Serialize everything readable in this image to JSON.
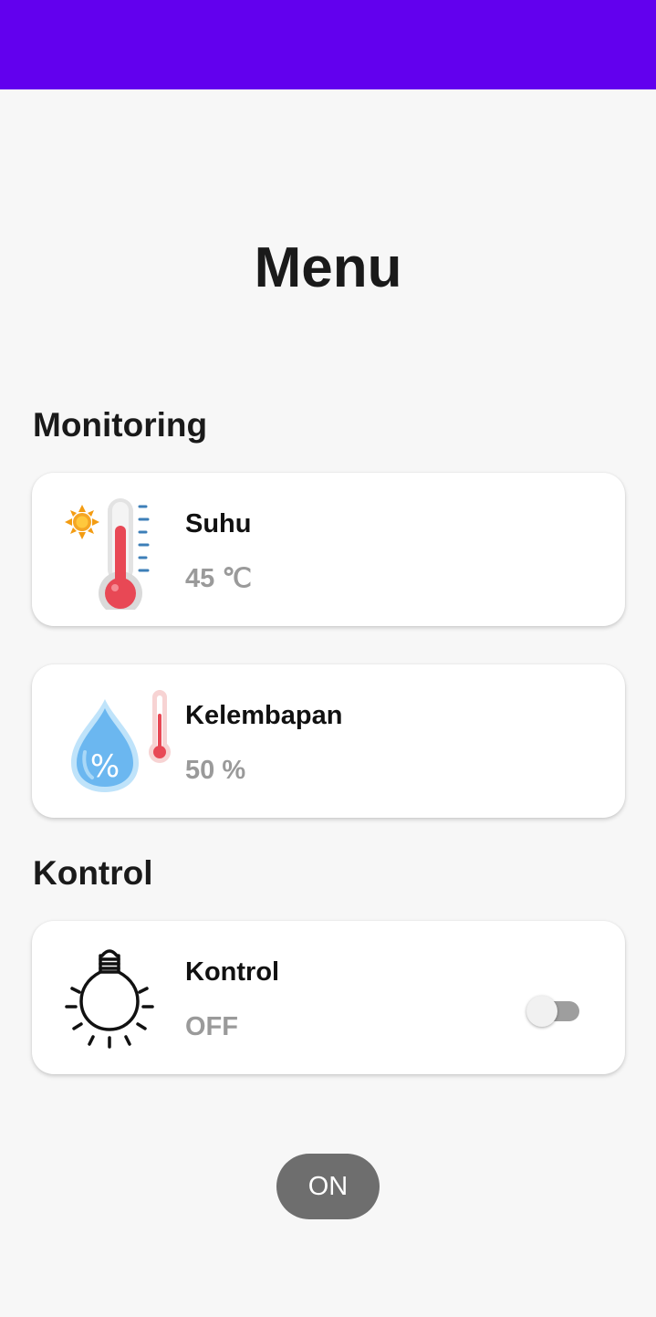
{
  "header": {
    "title": "Menu",
    "color": "#6200EE"
  },
  "monitoring": {
    "section_title": "Monitoring",
    "cards": [
      {
        "icon": "thermometer-sun-icon",
        "label": "Suhu",
        "value": "45 ℃"
      },
      {
        "icon": "humidity-drop-icon",
        "label": "Kelembapan",
        "value": "50 %"
      }
    ]
  },
  "kontrol": {
    "section_title": "Kontrol",
    "card": {
      "icon": "light-bulb-icon",
      "label": "Kontrol",
      "value": "OFF",
      "switch_on": false
    }
  },
  "on_button": {
    "label": "ON"
  }
}
